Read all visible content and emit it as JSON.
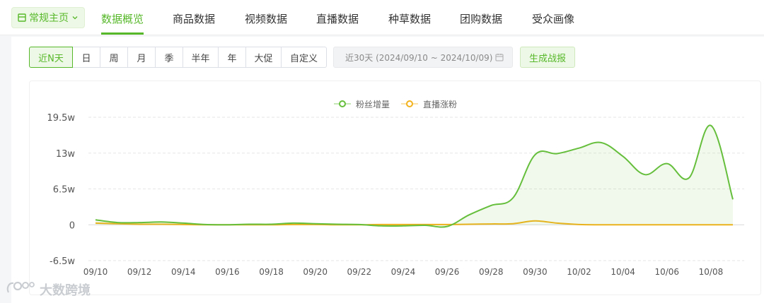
{
  "nav": {
    "home_label": "常规主页",
    "tabs": [
      "数据概览",
      "商品数据",
      "视频数据",
      "直播数据",
      "种草数据",
      "团购数据",
      "受众画像"
    ],
    "active_tab": 0
  },
  "toolbar": {
    "ranges": [
      "近N天",
      "日",
      "周",
      "月",
      "季",
      "半年",
      "年",
      "大促",
      "自定义"
    ],
    "active_range": 0,
    "date_range_text": "近30天 (2024/09/10 ~ 2024/10/09)",
    "generate_label": "生成战报"
  },
  "watermark": "大数跨境",
  "colors": {
    "accent": "#57b82a",
    "series1": "#66bf3c",
    "series2": "#f2b21c",
    "grid": "#e6e6e6"
  },
  "chart_data": {
    "type": "line",
    "y_unit": "w",
    "ylim": [
      -6.5,
      19.5
    ],
    "yticks": [
      "-6.5w",
      "0",
      "6.5w",
      "13w",
      "19.5w"
    ],
    "ytick_values": [
      -6.5,
      0,
      6.5,
      13,
      19.5
    ],
    "x": [
      "09/10",
      "09/11",
      "09/12",
      "09/13",
      "09/14",
      "09/15",
      "09/16",
      "09/17",
      "09/18",
      "09/19",
      "09/20",
      "09/21",
      "09/22",
      "09/23",
      "09/24",
      "09/25",
      "09/26",
      "09/27",
      "09/28",
      "09/29",
      "09/30",
      "10/01",
      "10/02",
      "10/03",
      "10/04",
      "10/05",
      "10/06",
      "10/07",
      "10/08",
      "10/09"
    ],
    "xtick_labels": [
      "09/10",
      "09/12",
      "09/14",
      "09/16",
      "09/18",
      "09/20",
      "09/22",
      "09/24",
      "09/26",
      "09/28",
      "09/30",
      "10/02",
      "10/04",
      "10/06",
      "10/08"
    ],
    "legend_position": "top-center",
    "series": [
      {
        "name": "粉丝增量",
        "area": true,
        "values": [
          0.9,
          0.4,
          0.4,
          0.5,
          0.3,
          0.05,
          0.0,
          0.1,
          0.1,
          0.3,
          0.2,
          0.1,
          0.05,
          -0.2,
          -0.2,
          -0.1,
          -0.3,
          1.8,
          3.5,
          4.9,
          12.7,
          12.9,
          13.9,
          14.9,
          12.4,
          9.1,
          11.1,
          8.5,
          18.0,
          4.6
        ]
      },
      {
        "name": "直播涨粉",
        "area": false,
        "values": [
          0.3,
          0.2,
          0.1,
          0.1,
          0.05,
          0.0,
          0.0,
          0.0,
          0.0,
          0.05,
          0.05,
          0.0,
          0.0,
          0.05,
          0.05,
          0.05,
          0.05,
          0.1,
          0.15,
          0.2,
          0.7,
          0.3,
          0.05,
          0.0,
          0.0,
          0.0,
          0.0,
          0.0,
          0.0,
          0.0
        ]
      }
    ]
  }
}
